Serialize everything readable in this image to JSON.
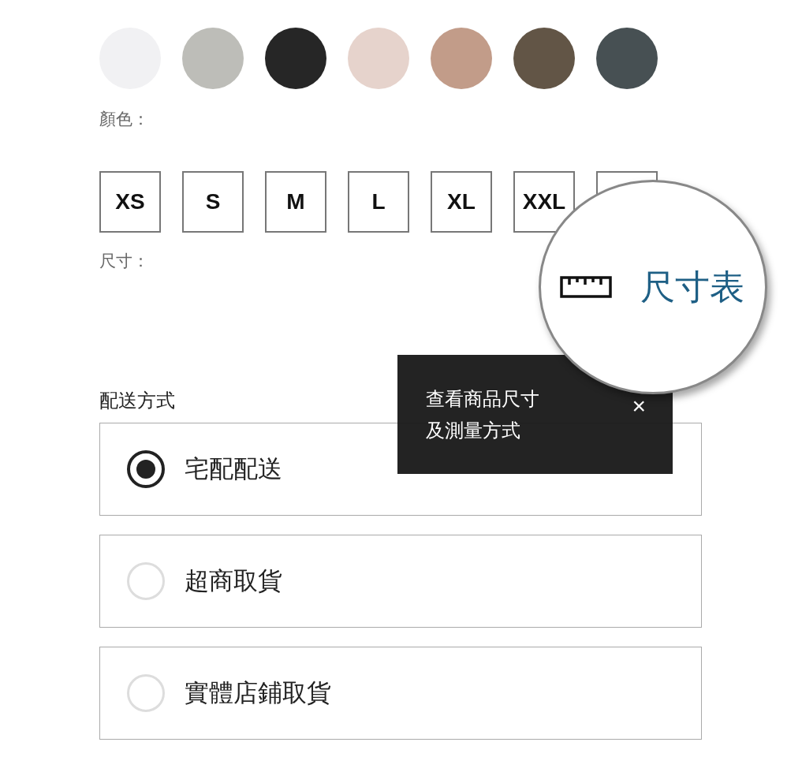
{
  "colors": {
    "swatches": [
      {
        "color": "#f1f1f3"
      },
      {
        "color": "#bdbdb8"
      },
      {
        "color": "#262626"
      },
      {
        "color": "#e6d3cc"
      },
      {
        "color": "#c29c89"
      },
      {
        "color": "#625546"
      },
      {
        "color": "#475053"
      }
    ],
    "label": "顏色："
  },
  "sizes": {
    "options": [
      "XS",
      "S",
      "M",
      "L",
      "XL",
      "XXL"
    ],
    "label": "尺寸："
  },
  "magnifier": {
    "link": "尺寸表"
  },
  "tooltip": {
    "lines": [
      "查看商品尺寸",
      "及測量方式"
    ],
    "close": "×"
  },
  "shipping": {
    "title": "配送方式",
    "options": [
      {
        "label": "宅配配送",
        "selected": true
      },
      {
        "label": "超商取貨",
        "selected": false
      },
      {
        "label": "實體店鋪取貨",
        "selected": false
      }
    ]
  }
}
